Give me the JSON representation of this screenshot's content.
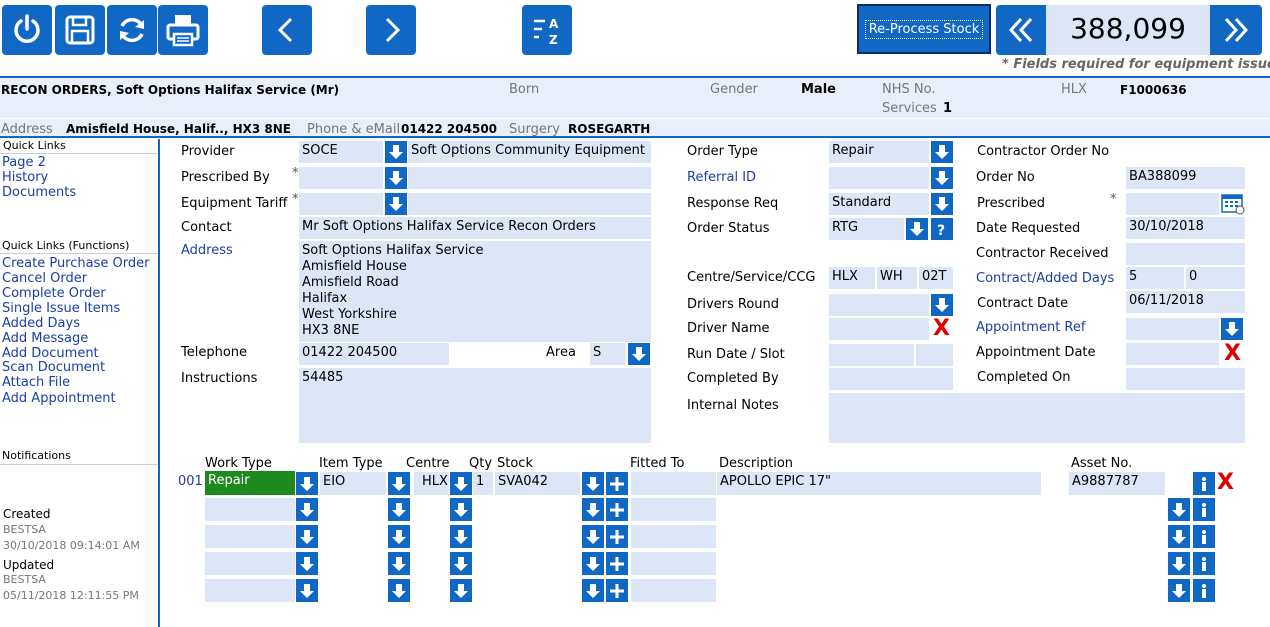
{
  "toolbar": {
    "reprocess_label": "Re-Process Stock",
    "record_number": "388,099",
    "required_note": "* Fields required for equipment issues"
  },
  "patient": {
    "name": "RECON ORDERS, Soft Options Halifax Service (Mr)",
    "born_label": "Born",
    "gender_label": "Gender",
    "gender_value": "Male",
    "nhs_label": "NHS No.",
    "services_label": "Services",
    "services_value": "1",
    "hlx_label": "HLX",
    "hlx_value": "F1000636",
    "address_label": "Address",
    "address_value": "Amisfield House, Halif.., HX3 8NE",
    "phone_label": "Phone & eMail",
    "phone_value": "01422 204500",
    "surgery_label": "Surgery",
    "surgery_value": "ROSEGARTH"
  },
  "sidebar": {
    "quick_links_title": "Quick Links",
    "links": [
      "Page 2",
      "History",
      "Documents"
    ],
    "functions_title": "Quick Links (Functions)",
    "functions": [
      "Create Purchase Order",
      "Cancel Order",
      "Complete Order",
      "Single Issue Items",
      "Added Days",
      "Add Message",
      "Add Document",
      "Scan Document",
      "Attach File",
      "Add Appointment"
    ],
    "notifications_title": "Notifications",
    "created_label": "Created",
    "created_by": "BESTSA",
    "created_at": "30/10/2018 09:14:01 AM",
    "updated_label": "Updated",
    "updated_by": "BESTSA",
    "updated_at": "05/11/2018 12:11:55 PM"
  },
  "form": {
    "provider_label": "Provider",
    "provider_code": "SOCE",
    "provider_name": "Soft Options Community Equipment",
    "prescribed_by_label": "Prescribed By",
    "tariff_label": "Equipment Tariff",
    "contact_label": "Contact",
    "contact_value": "Mr Soft Options Halifax Service Recon Orders",
    "address_label": "Address",
    "address_lines": [
      "Soft Options Halifax Service",
      "Amisfield House",
      "Amisfield Road",
      "Halifax",
      "West Yorkshire",
      "HX3 8NE"
    ],
    "telephone_label": "Telephone",
    "telephone_value": "01422 204500",
    "area_label": "Area",
    "area_value": "S",
    "instructions_label": "Instructions",
    "instructions_value": "54485",
    "order_type_label": "Order Type",
    "order_type_value": "Repair",
    "referral_label": "Referral ID",
    "response_label": "Response Req",
    "response_value": "Standard",
    "status_label": "Order Status",
    "status_value": "RTG",
    "centre_label": "Centre/Service/CCG",
    "centre_value": "HLX",
    "service_value": "WH",
    "ccg_value": "02T",
    "drivers_round_label": "Drivers Round",
    "driver_name_label": "Driver Name",
    "run_date_label": "Run Date / Slot",
    "completed_by_label": "Completed By",
    "internal_notes_label": "Internal Notes",
    "contractor_order_label": "Contractor Order No",
    "order_no_label": "Order No",
    "order_no_value": "BA388099",
    "prescribed_label": "Prescribed",
    "date_requested_label": "Date Requested",
    "date_requested_value": "30/10/2018",
    "contractor_received_label": "Contractor Received",
    "contract_days_label": "Contract/Added Days",
    "contract_days_value": "5",
    "added_days_value": "0",
    "contract_date_label": "Contract Date",
    "contract_date_value": "06/11/2018",
    "appointment_ref_label": "Appointment Ref",
    "appointment_date_label": "Appointment Date",
    "completed_on_label": "Completed On"
  },
  "items": {
    "headers": {
      "work_type": "Work Type",
      "item_type": "Item Type",
      "centre": "Centre",
      "qty": "Qty",
      "stock": "Stock",
      "fitted_to": "Fitted To",
      "description": "Description",
      "asset": "Asset No."
    },
    "row1": {
      "num": "001",
      "work_type": "Repair",
      "item_type": "EIO",
      "centre": "HLX",
      "qty": "1",
      "stock": "SVA042",
      "description": "APOLLO EPIC 17\"",
      "asset": "A9887787"
    }
  },
  "colors": {
    "accent": "#1167c4",
    "field_bg": "#dce6f7",
    "header_bg": "#e8eefa",
    "work_type_bg": "#1e8a1e",
    "red": "#e00000"
  }
}
